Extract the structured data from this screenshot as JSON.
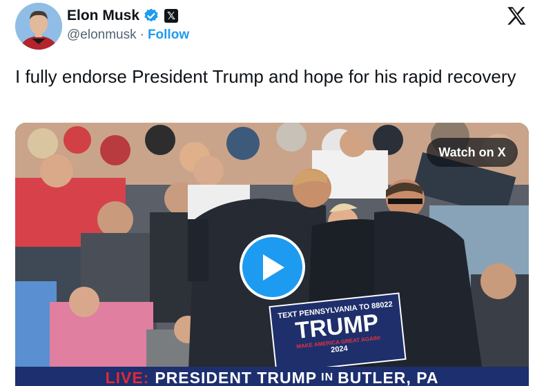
{
  "author": {
    "name": "Elon Musk",
    "handle": "@elonmusk",
    "separator": "·",
    "follow_label": "Follow",
    "badge_x": "𝕏"
  },
  "tweet": {
    "text": "I fully endorse President Trump and hope for his rapid recovery"
  },
  "media": {
    "watch_label": "Watch on X",
    "banner": {
      "live": "LIVE:",
      "part1": "PRESIDENT TRUMP",
      "part2": "IN",
      "part3": "BUTLER, PA"
    },
    "sign": {
      "top": "TEXT PENNSYLVANIA TO 88022",
      "main": "TRUMP",
      "bottom": "MAKE AMERICA GREAT AGAIN!",
      "year": "2024"
    }
  },
  "colors": {
    "accent": "#1d9bf0",
    "banner": "#1d2f6e",
    "live": "#e02a35"
  }
}
